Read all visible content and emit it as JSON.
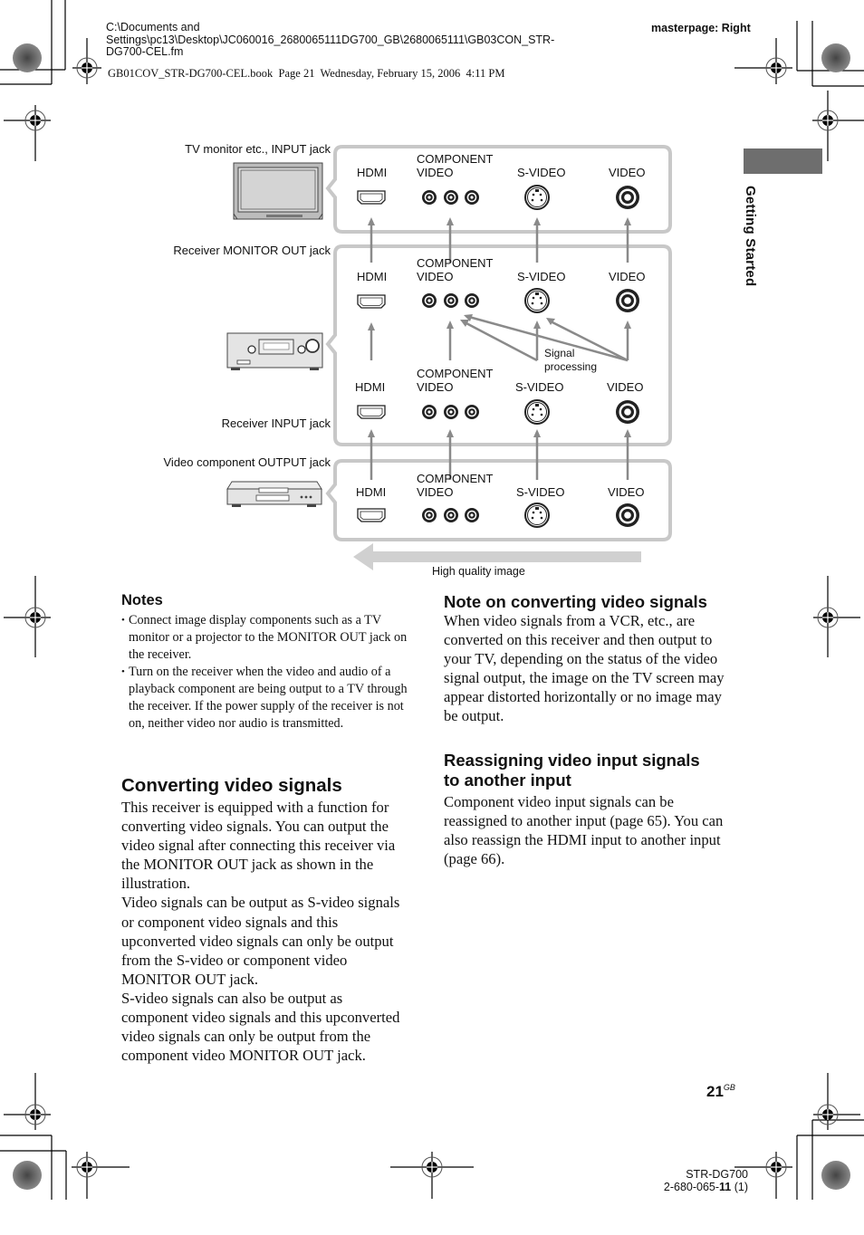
{
  "header": {
    "file_path_lines": [
      "C:\\Documents and",
      "Settings\\pc13\\Desktop\\JC060016_2680065111DG700_GB\\2680065111\\GB03CON_STR-",
      "DG700-CEL.fm"
    ],
    "book_info": "GB01COV_STR-DG700-CEL.book  Page 21  Wednesday, February 15, 2006  4:11 PM",
    "masterpage": "masterpage: Right"
  },
  "side_tab": {
    "label": "Getting Started",
    "color": "#6e6e6e"
  },
  "diagram": {
    "device_labels": {
      "tv": "TV monitor etc., INPUT jack",
      "monitor_out": "Receiver MONITOR OUT jack",
      "receiver_input": "Receiver INPUT jack",
      "video_component": "Video component OUTPUT jack"
    },
    "devices": {
      "tv": "tv-monitor-icon",
      "receiver": "av-receiver-icon",
      "player": "dvd-player-icon"
    },
    "jack_labels": {
      "hdmi": "HDMI",
      "component_line1": "COMPONENT",
      "component_line2": "VIDEO",
      "svideo": "S-VIDEO",
      "video": "VIDEO"
    },
    "signal_processing": [
      "Signal",
      "processing"
    ],
    "quality_arrow_label": "High quality image",
    "colors": {
      "panel_border": "#c8c8c8",
      "arrow": "#8a8a8a",
      "quality_arrow": "#d0d0d0"
    }
  },
  "notes": {
    "heading": "Notes",
    "items": [
      "Connect image display components such as a TV monitor or a projector to the MONITOR OUT jack on the receiver.",
      "Turn on the receiver when the video and audio of a playback component are being output to a TV through the receiver. If the power supply of the receiver is not on, neither video nor audio is transmitted."
    ]
  },
  "converting": {
    "heading": "Converting video signals",
    "paragraphs": [
      "This receiver is equipped with a function for converting video signals. You can output the video signal after connecting this receiver via the MONITOR OUT jack as shown in the illustration.",
      "Video signals can be output as S-video signals or component video signals and this upconverted video signals can only be output from the S-video or component video MONITOR OUT jack.",
      "S-video signals can also be output as component video signals and this upconverted video signals can only be output from the component video MONITOR OUT jack."
    ]
  },
  "note_converting": {
    "heading": "Note on converting video signals",
    "text": "When video signals from a VCR, etc., are converted on this receiver and then output to your TV, depending on the status of the video signal output, the image on the TV screen may appear distorted horizontally or no image may be output."
  },
  "reassigning": {
    "heading_line1": "Reassigning video input signals",
    "heading_line2": "to another input",
    "text": "Component video input signals can be reassigned to another input (page 65). You can also reassign the HDMI input to another input (page 66)."
  },
  "footer": {
    "page_number": "21",
    "page_suffix": "GB",
    "model": "STR-DG700",
    "part_number_prefix": "2-680-065-",
    "part_number_bold": "11",
    "part_number_suffix": " (1)"
  }
}
